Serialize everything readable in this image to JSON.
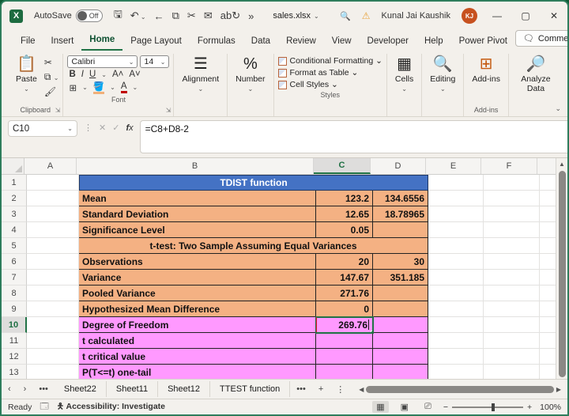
{
  "title_bar": {
    "autosave_label": "AutoSave",
    "autosave_state": "Off",
    "file_name": "sales.xlsx",
    "user_name": "Kunal Jai Kaushik",
    "user_initials": "KJ"
  },
  "ribbon_tabs": [
    {
      "label": "File"
    },
    {
      "label": "Insert"
    },
    {
      "label": "Home"
    },
    {
      "label": "Page Layout"
    },
    {
      "label": "Formulas"
    },
    {
      "label": "Data"
    },
    {
      "label": "Review"
    },
    {
      "label": "View"
    },
    {
      "label": "Developer"
    },
    {
      "label": "Help"
    },
    {
      "label": "Power Pivot"
    }
  ],
  "comments_label": "Comments",
  "ribbon": {
    "clipboard": {
      "group_label": "Clipboard",
      "paste_label": "Paste"
    },
    "font": {
      "group_label": "Font",
      "font_name": "Calibri",
      "font_size": "14"
    },
    "alignment": {
      "group_label": "Alignment"
    },
    "number": {
      "group_label": "Number"
    },
    "styles": {
      "group_label": "Styles",
      "conditional_formatting": "Conditional Formatting ⌄",
      "format_as_table": "Format as Table ⌄",
      "cell_styles": "Cell Styles ⌄"
    },
    "cells": {
      "group_label": "Cells"
    },
    "editing": {
      "group_label": "Editing"
    },
    "addins": {
      "group_label": "Add-ins",
      "button_label": "Add-ins"
    },
    "analyze": {
      "button_label": "Analyze Data"
    }
  },
  "formula_bar": {
    "name_box": "C10",
    "formula": "=C8+D8-2"
  },
  "grid": {
    "selected_cell": "C10",
    "column_headers": [
      "A",
      "B",
      "C",
      "D",
      "E",
      "F"
    ],
    "rows": [
      {
        "n": "1",
        "merged": "TDIST function"
      },
      {
        "n": "2",
        "b": "Mean",
        "c": "123.2",
        "d": "134.6556"
      },
      {
        "n": "3",
        "b": "Standard Deviation",
        "c": "12.65",
        "d": "18.78965"
      },
      {
        "n": "4",
        "b": "Significance Level",
        "c": "0.05",
        "d": ""
      },
      {
        "n": "5",
        "merged": "t-test: Two Sample Assuming Equal Variances"
      },
      {
        "n": "6",
        "b": "Observations",
        "c": "20",
        "d": "30"
      },
      {
        "n": "7",
        "b": "Variance",
        "c": "147.67",
        "d": "351.185"
      },
      {
        "n": "8",
        "b": "Pooled Variance",
        "c": "271.76",
        "d": ""
      },
      {
        "n": "9",
        "b": "Hypothesized Mean Difference",
        "c": "0",
        "d": ""
      },
      {
        "n": "10",
        "b": "Degree of Freedom",
        "c": "269.76",
        "d": ""
      },
      {
        "n": "11",
        "b": "t calculated",
        "c": "",
        "d": ""
      },
      {
        "n": "12",
        "b": "t critical value",
        "c": "",
        "d": ""
      },
      {
        "n": "13",
        "b": "P(T<=t) one-tail",
        "c": "",
        "d": ""
      }
    ]
  },
  "sheet_tabs": [
    {
      "label": "Sheet22"
    },
    {
      "label": "Sheet11"
    },
    {
      "label": "Sheet12"
    },
    {
      "label": "TTEST function"
    }
  ],
  "status_bar": {
    "mode": "Ready",
    "accessibility": "Accessibility: Investigate",
    "zoom_level": "100%"
  },
  "colors": {
    "header_blue": "#4472C4",
    "band_orange": "#F4B183",
    "band_pink": "#FF99FF",
    "annotation_red": "#E8112D",
    "excel_green": "#217346"
  }
}
